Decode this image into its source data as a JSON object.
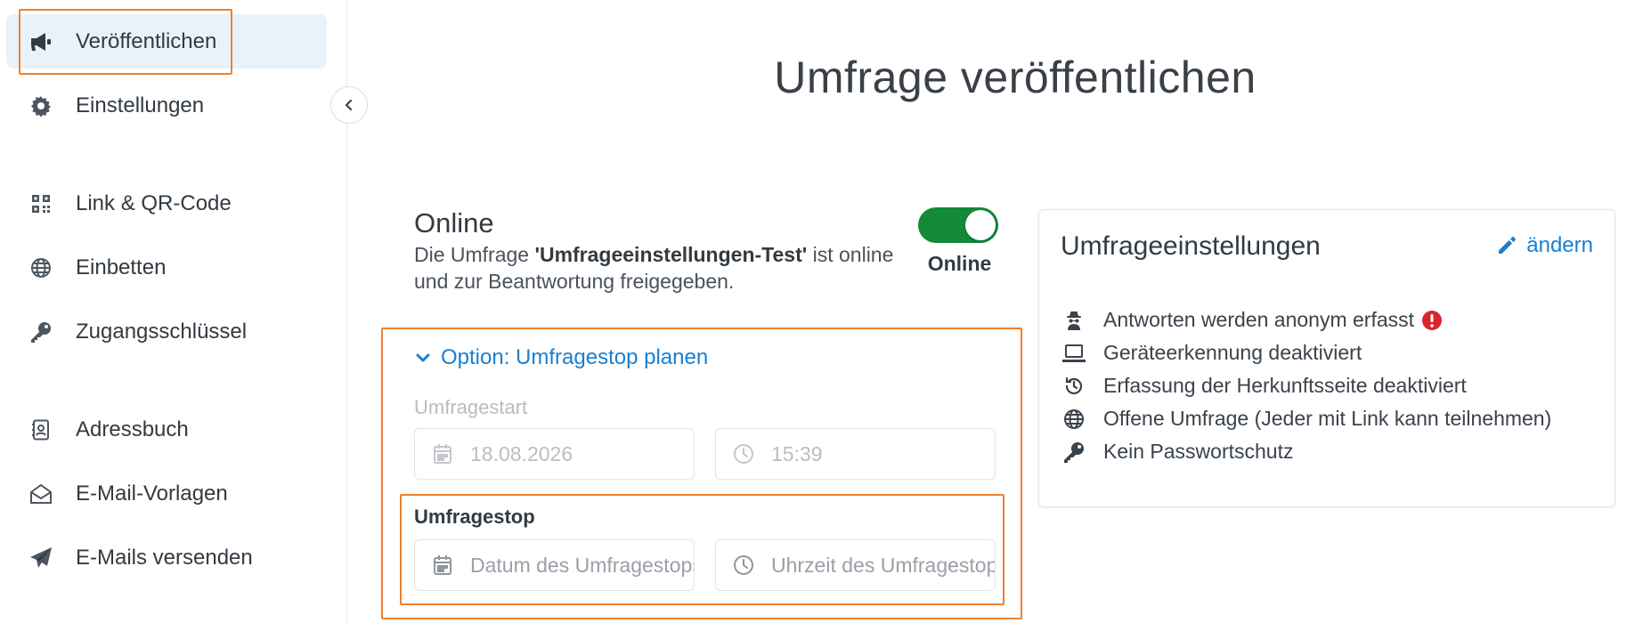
{
  "sidebar": {
    "items": [
      {
        "label": "Veröffentlichen",
        "icon": "megaphone-icon"
      },
      {
        "label": "Einstellungen",
        "icon": "gear-icon"
      },
      {
        "label": "Link & QR-Code",
        "icon": "qr-code-icon"
      },
      {
        "label": "Einbetten",
        "icon": "globe-icon"
      },
      {
        "label": "Zugangsschlüssel",
        "icon": "key-icon"
      },
      {
        "label": "Adressbuch",
        "icon": "address-book-icon"
      },
      {
        "label": "E-Mail-Vorlagen",
        "icon": "envelope-open-icon"
      },
      {
        "label": "E-Mails versenden",
        "icon": "paper-plane-icon"
      }
    ]
  },
  "main": {
    "title": "Umfrage veröffentlichen",
    "status": {
      "heading": "Online",
      "desc_prefix": "Die Umfrage ",
      "survey_name": "'Umfrageeinstellungen-Test'",
      "desc_suffix": " ist online und zur Beantwortung freigegeben.",
      "toggle_label": "Online",
      "toggle_on": true
    },
    "schedule": {
      "option_label": "Option: Umfragestop planen",
      "start_label": "Umfragestart",
      "start_date": "18.08.2026",
      "start_time": "15:39",
      "stop_label": "Umfragestop",
      "stop_date_placeholder": "Datum des Umfragestops",
      "stop_time_placeholder": "Uhrzeit des Umfragestops"
    }
  },
  "settings_card": {
    "title": "Umfrageeinstellungen",
    "edit_label": "ändern",
    "items": [
      {
        "label": "Antworten werden anonym erfasst",
        "icon": "anonymous-icon",
        "warning": true
      },
      {
        "label": "Geräteerkennung deaktiviert",
        "icon": "laptop-icon"
      },
      {
        "label": "Erfassung der Herkunftsseite deaktiviert",
        "icon": "history-icon"
      },
      {
        "label": "Offene Umfrage (Jeder mit Link kann teilnehmen)",
        "icon": "globe-icon"
      },
      {
        "label": "Kein Passwortschutz",
        "icon": "key-icon"
      }
    ]
  },
  "colors": {
    "accent": "#1a7fd0",
    "toggle_on": "#128a36",
    "highlight": "#f07f2d",
    "warning": "#d9262c",
    "active_nav_bg": "#e9f2fb"
  }
}
